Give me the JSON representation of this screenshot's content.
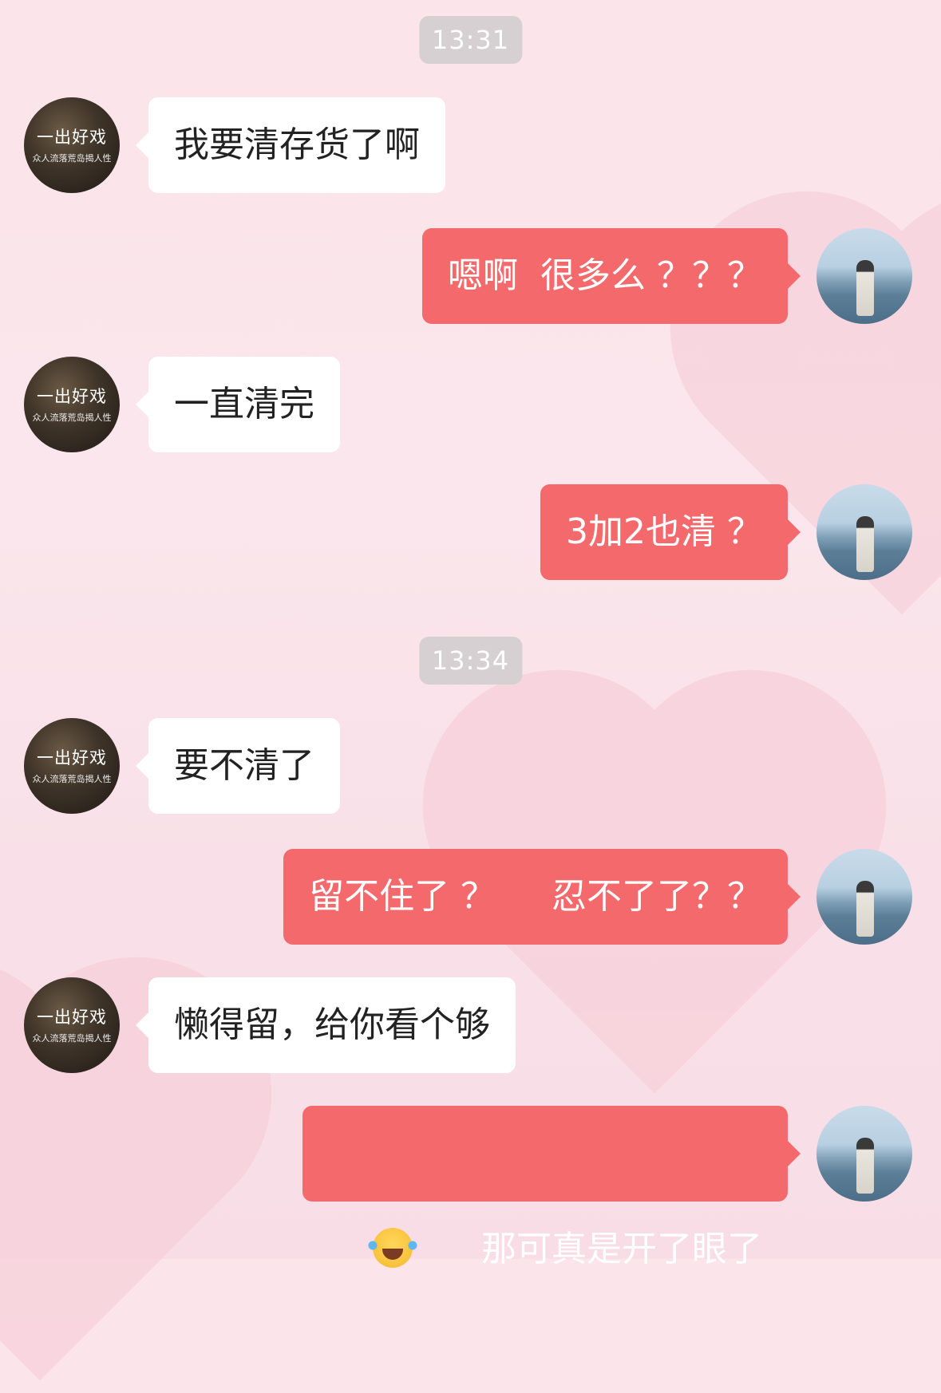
{
  "timestamps": [
    "13:31",
    "13:34"
  ],
  "contact": {
    "avatar_title": "一出好戏",
    "avatar_subtitle": "众人流落荒岛揭人性"
  },
  "messages": [
    {
      "from": "them",
      "text": "我要清存货了啊"
    },
    {
      "from": "me",
      "text": "嗯啊  很多么 ？？？"
    },
    {
      "from": "them",
      "text": "一直清完"
    },
    {
      "from": "me",
      "text": "3加2也清 ？"
    },
    {
      "from": "them",
      "text": "要不清了"
    },
    {
      "from": "me",
      "text": "留不住了 ？     忍不了了？？"
    },
    {
      "from": "them",
      "text": "懒得留，给你看个够"
    },
    {
      "from": "me",
      "text": "那可真是开了眼了",
      "emoji": "face-with-tears-of-joy-icon"
    }
  ],
  "colors": {
    "outgoing_bubble": "#f46a6c",
    "incoming_bubble": "#ffffff",
    "timestamp_bg": "#d6d0d2",
    "background": "#fbe4ea"
  }
}
